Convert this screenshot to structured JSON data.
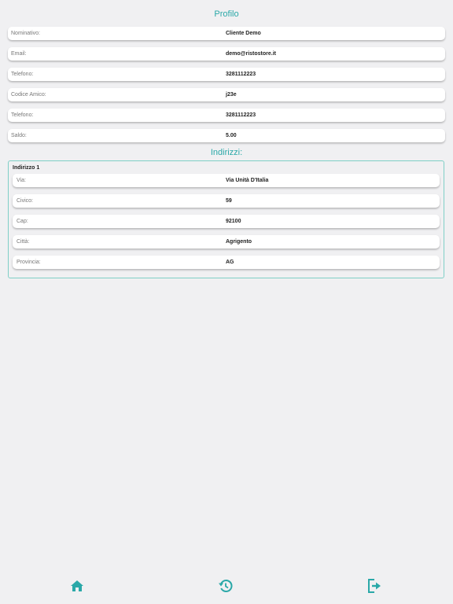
{
  "profile": {
    "title": "Profilo",
    "fields": [
      {
        "label": "Nominativo:",
        "value": "Cliente Demo"
      },
      {
        "label": "Email:",
        "value": "demo@ristostore.it"
      },
      {
        "label": "Telefono:",
        "value": "3281112223"
      },
      {
        "label": "Codice Amico:",
        "value": "j23e"
      },
      {
        "label": "Telefono:",
        "value": "3281112223"
      },
      {
        "label": "Saldo:",
        "value": "5.00"
      }
    ]
  },
  "addresses": {
    "title": "Indirizzi:",
    "items": [
      {
        "heading": "Indirizzo 1",
        "fields": [
          {
            "label": "Via:",
            "value": "Via Unità D'Italia"
          },
          {
            "label": "Civico:",
            "value": "59"
          },
          {
            "label": "Cap:",
            "value": "92100"
          },
          {
            "label": "Città:",
            "value": "Agrigento"
          },
          {
            "label": "Provincia:",
            "value": "AG"
          }
        ]
      }
    ]
  },
  "nav": {
    "items": [
      {
        "icon": "home-icon"
      },
      {
        "icon": "history-icon"
      },
      {
        "icon": "logout-icon"
      }
    ],
    "accent": "#2aa8a8"
  }
}
